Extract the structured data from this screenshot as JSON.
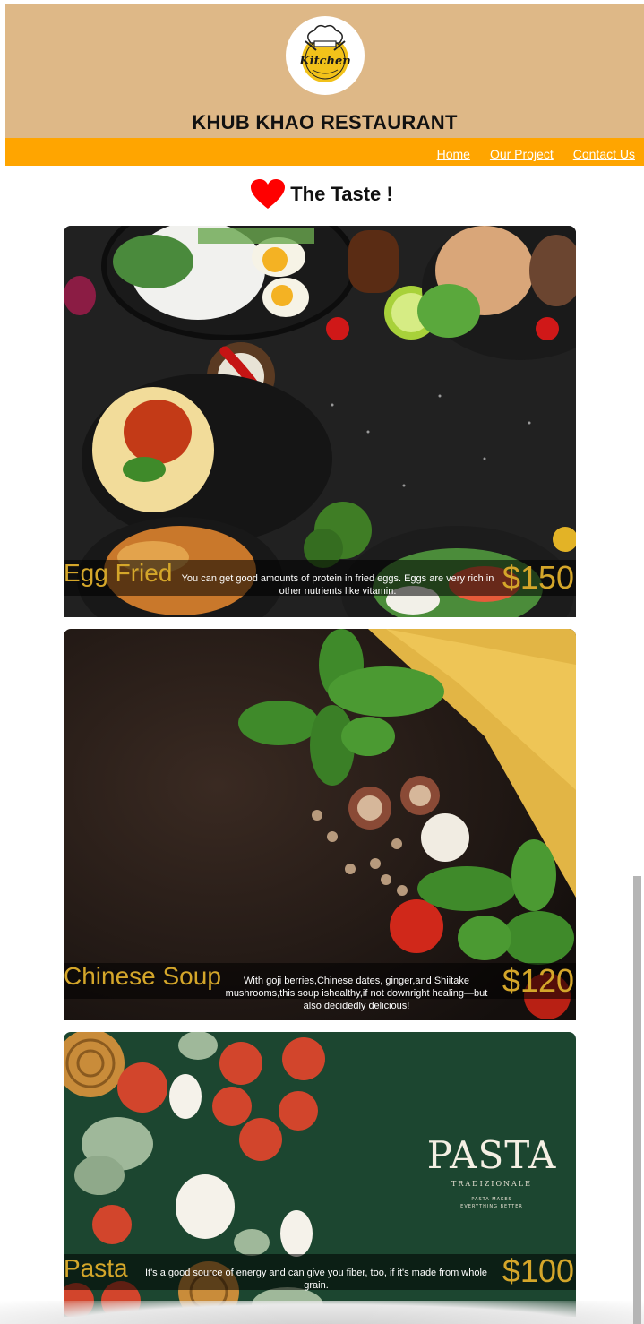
{
  "site": {
    "title": "KHUB KHAO RESTAURANT",
    "logo_text": "Kitchen"
  },
  "nav": {
    "items": [
      "Home",
      "Our Project",
      "Contact Us"
    ]
  },
  "tagline": {
    "icon": "heart-icon",
    "text": "The Taste !"
  },
  "menu": [
    {
      "name": "Egg Fried",
      "description": "You can get good amounts of protein in fried eggs. Eggs are very rich in other nutrients like vitamin.",
      "price": "$150"
    },
    {
      "name": "Chinese Soup",
      "description": "With goji berries,Chinese dates, ginger,and Shiitake mushrooms,this soup ishealthy,if not downright healing—but also decidedly delicious!",
      "price": "$120"
    },
    {
      "name": "Pasta",
      "description": "It's a good source of energy and can give you fiber, too, if it's made from whole grain.",
      "price": "$100"
    }
  ],
  "pasta_art": {
    "brand": "PASTA",
    "subtitle": "TRADIZIONALE",
    "tagline_line1": "PASTA MAKES",
    "tagline_line2": "EVERYTHING BETTER"
  },
  "colors": {
    "header_bg": "#deb887",
    "nav_bg": "#ffa500",
    "price_gold": "#d4a62a",
    "heart_red": "#ff0000"
  }
}
